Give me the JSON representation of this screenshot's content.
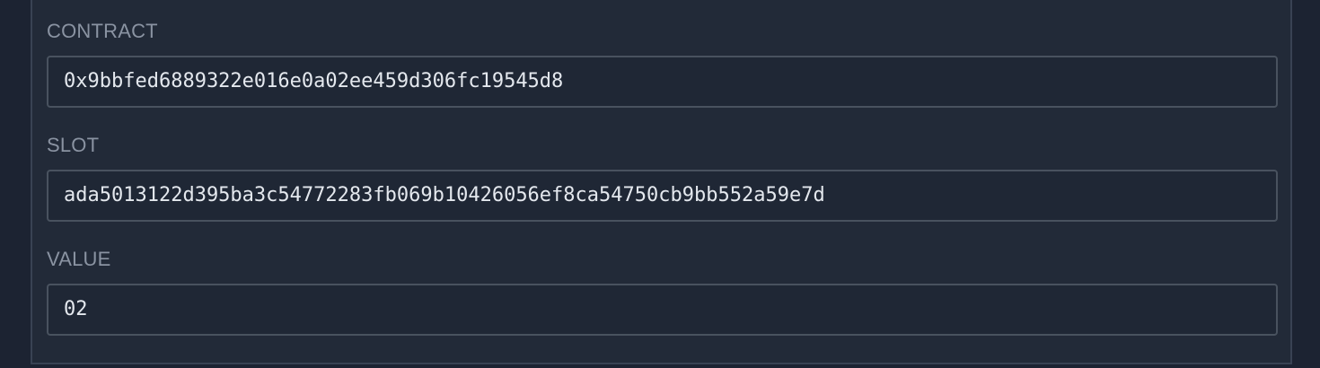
{
  "fields": {
    "contract": {
      "label": "CONTRACT",
      "value": "0x9bbfed6889322e016e0a02ee459d306fc19545d8"
    },
    "slot": {
      "label": "SLOT",
      "value": "ada5013122d395ba3c54772283fb069b10426056ef8ca54750cb9bb552a59e7d"
    },
    "value": {
      "label": "VALUE",
      "value": "02"
    }
  },
  "colors": {
    "background": "#1c2332",
    "panel": "#222a38",
    "panel_border": "#394253",
    "field_background": "#1f2735",
    "field_border": "#49525f",
    "label_text": "#8a93a2",
    "value_text": "#e4e8ee"
  }
}
